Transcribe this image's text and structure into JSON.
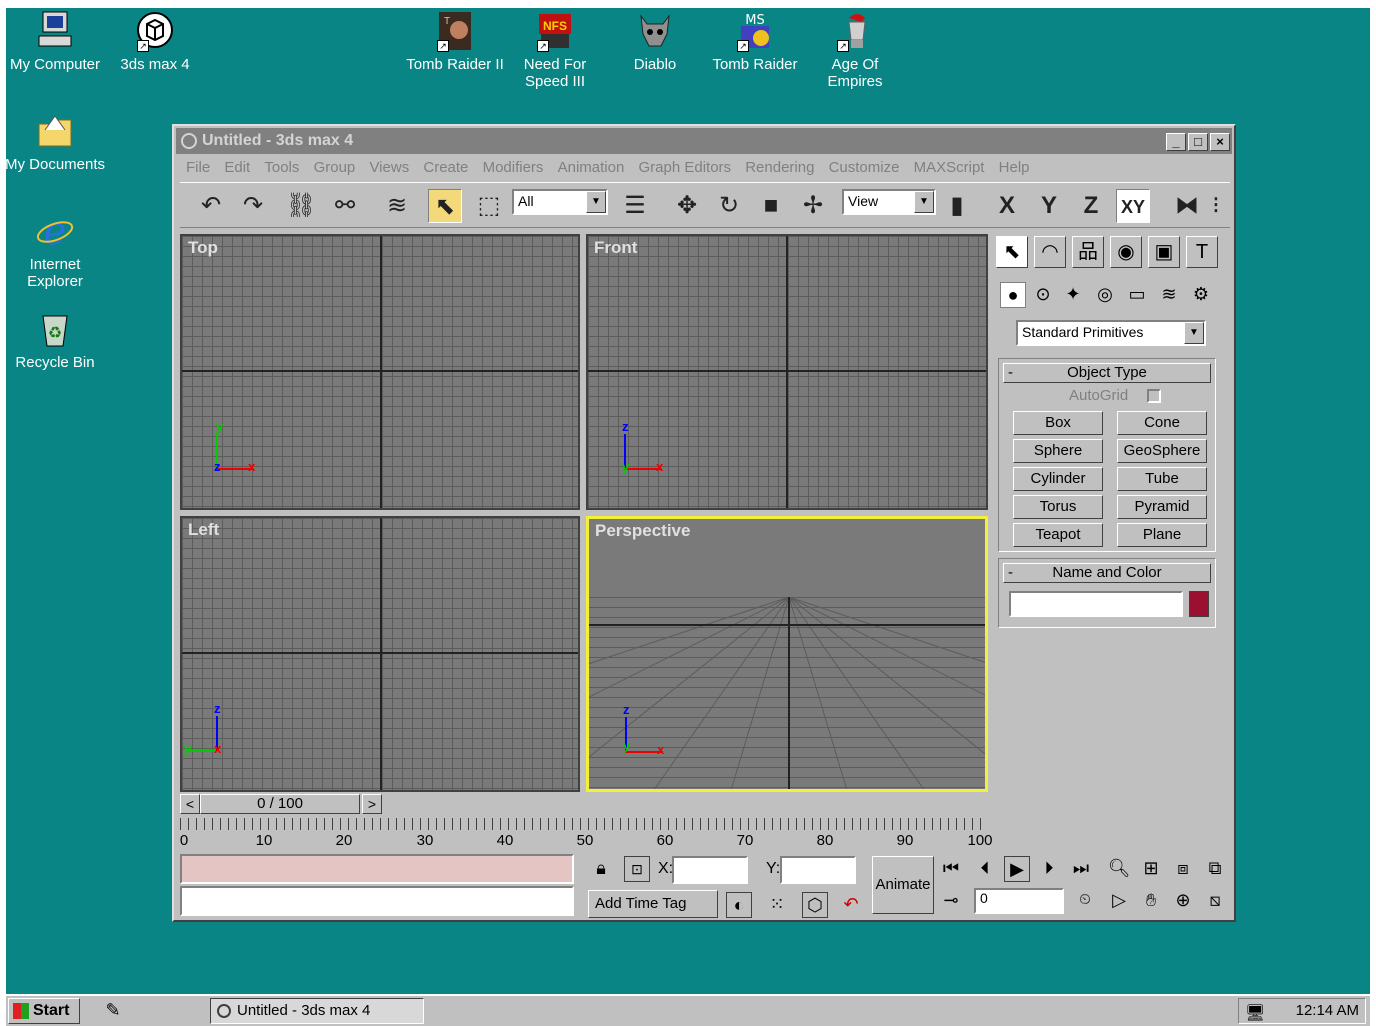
{
  "desktop": {
    "icons": [
      {
        "label": "My Computer",
        "icon": "computer-icon"
      },
      {
        "label": "3ds max 4",
        "icon": "3dsmax-icon"
      },
      {
        "label": "My Documents",
        "icon": "folder-icon"
      },
      {
        "label": "Internet Explorer",
        "icon": "internet-explorer-icon"
      },
      {
        "label": "Recycle Bin",
        "icon": "recycle-bin-icon"
      },
      {
        "label": "Tomb Raider II",
        "icon": "tomb-raider-icon"
      },
      {
        "label": "Need For Speed III",
        "icon": "need-for-speed-icon"
      },
      {
        "label": "Diablo",
        "icon": "diablo-icon"
      },
      {
        "label": "Tomb Raider",
        "icon": "tomb-raider-ms-icon"
      },
      {
        "label": "Age Of Empires",
        "icon": "age-of-empires-icon"
      }
    ]
  },
  "window": {
    "title": "Untitled - 3ds max 4",
    "controls": {
      "minimize": "_",
      "maximize": "□",
      "close": "×"
    },
    "menu": [
      "File",
      "Edit",
      "Tools",
      "Group",
      "Views",
      "Create",
      "Modifiers",
      "Animation",
      "Graph Editors",
      "Rendering",
      "Customize",
      "MAXScript",
      "Help"
    ],
    "toolbar": {
      "selection_filter": "All",
      "reference_coord": "View",
      "axis_x": "X",
      "axis_y": "Y",
      "axis_z": "Z",
      "axis_xy": "XY"
    },
    "viewports": {
      "top": "Top",
      "front": "Front",
      "left": "Left",
      "perspective": "Perspective"
    },
    "axis_labels": {
      "x": "x",
      "y": "y",
      "z": "z"
    },
    "command_panel": {
      "category": "Standard Primitives",
      "object_type": {
        "header": "Object Type",
        "minus": "-",
        "autogrid": "AutoGrid",
        "buttons": [
          "Box",
          "Cone",
          "Sphere",
          "GeoSphere",
          "Cylinder",
          "Tube",
          "Torus",
          "Pyramid",
          "Teapot",
          "Plane"
        ]
      },
      "name_color": {
        "header": "Name and Color",
        "minus": "-",
        "name_value": "",
        "color": "#9b1030"
      }
    },
    "timeline": {
      "slider": "0 / 100",
      "prev": "<",
      "next": ">",
      "ticks": [
        "0",
        "10",
        "20",
        "30",
        "40",
        "50",
        "60",
        "70",
        "80",
        "90",
        "100"
      ]
    },
    "status": {
      "x_label": "X:",
      "y_label": "Y:",
      "x_value": "",
      "y_value": "",
      "add_time_tag": "Add Time Tag",
      "animate": "Animate",
      "frame_value": "0"
    }
  },
  "taskbar": {
    "start": "Start",
    "task": "Untitled - 3ds max 4",
    "clock": "12:14 AM"
  }
}
